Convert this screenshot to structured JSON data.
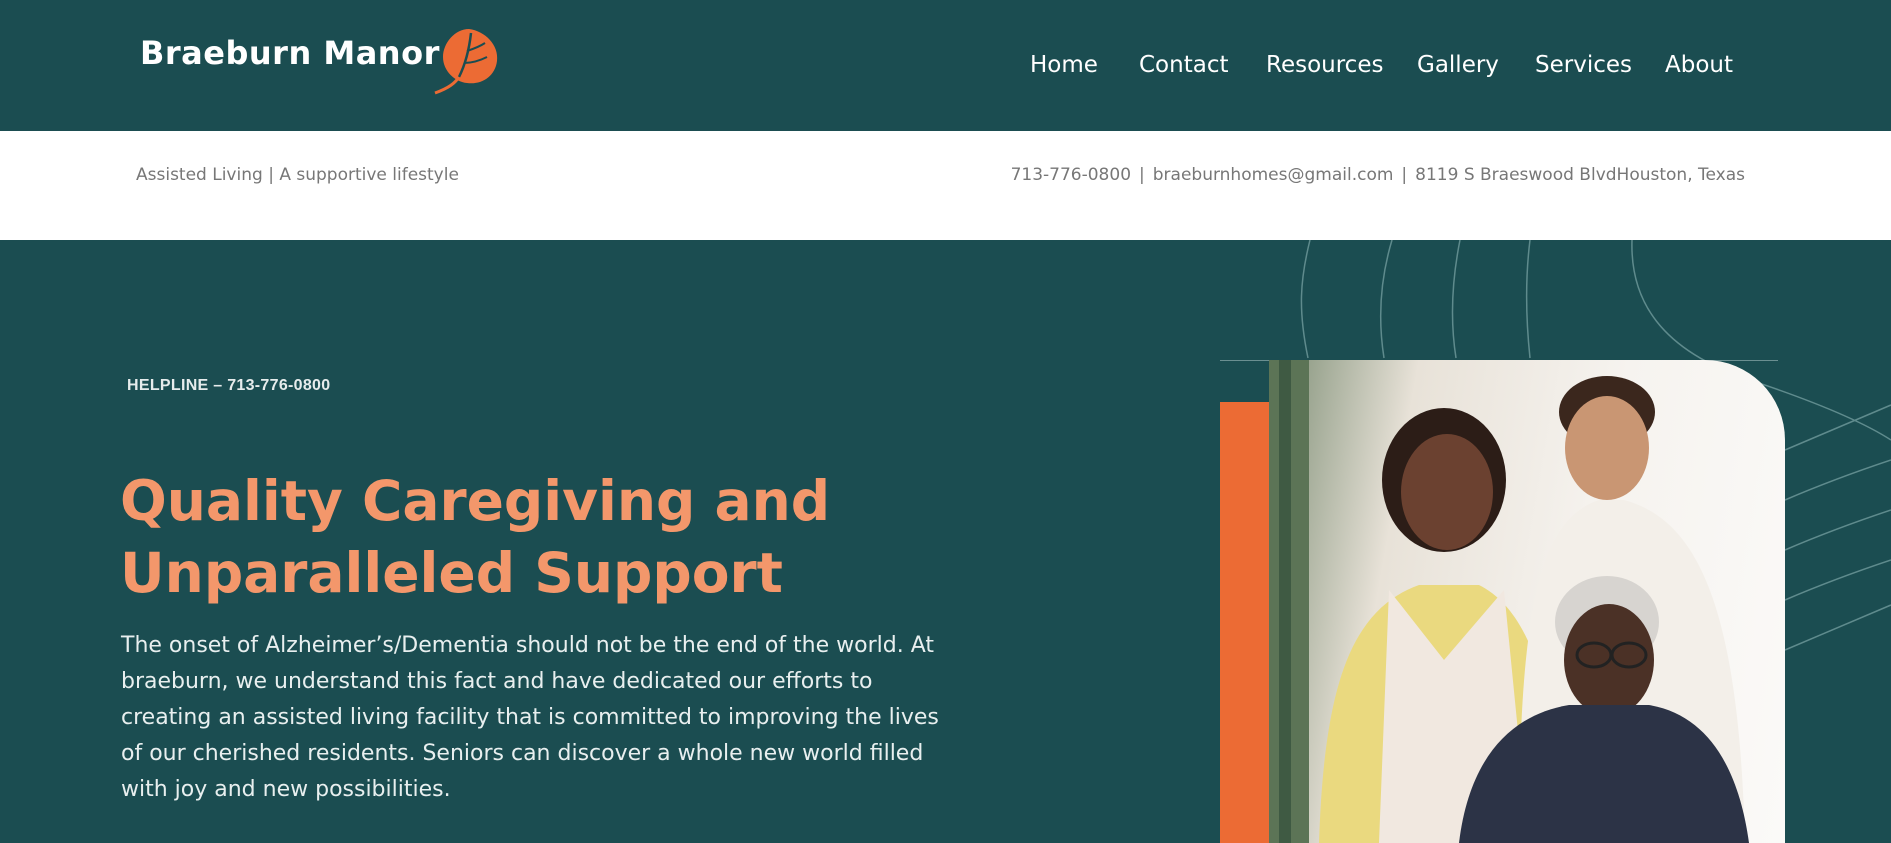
{
  "header": {
    "brand": "Braeburn Manor",
    "nav": [
      "Home",
      "Contact",
      "Resources",
      "Gallery",
      "Services",
      "About"
    ]
  },
  "infobar": {
    "tagline": "Assisted Living | A supportive lifestyle",
    "phone": "713-776-0800",
    "email": "braeburnhomes@gmail.com",
    "address": "8119 S Braeswood BlvdHouston, Texas",
    "separator": "|"
  },
  "hero": {
    "helpline": "HELPLINE – 713-776-0800",
    "headline_line1": "Quality Caregiving and",
    "headline_line2": "Unparalleled Support",
    "body": "The onset of Alzheimer’s/Dementia should not be the end of the world. At braeburn, we understand this fact and have dedicated our efforts to creating an assisted living facility that is committed to improving the lives of our cherished residents. Seniors can discover a whole new world filled with joy and new possibilities."
  },
  "colors": {
    "primary_teal": "#1b4d51",
    "accent_orange": "#ec6b34",
    "headline_peach": "#f3976b",
    "white": "#ffffff"
  },
  "icons": {
    "logo": "leaf-icon"
  }
}
